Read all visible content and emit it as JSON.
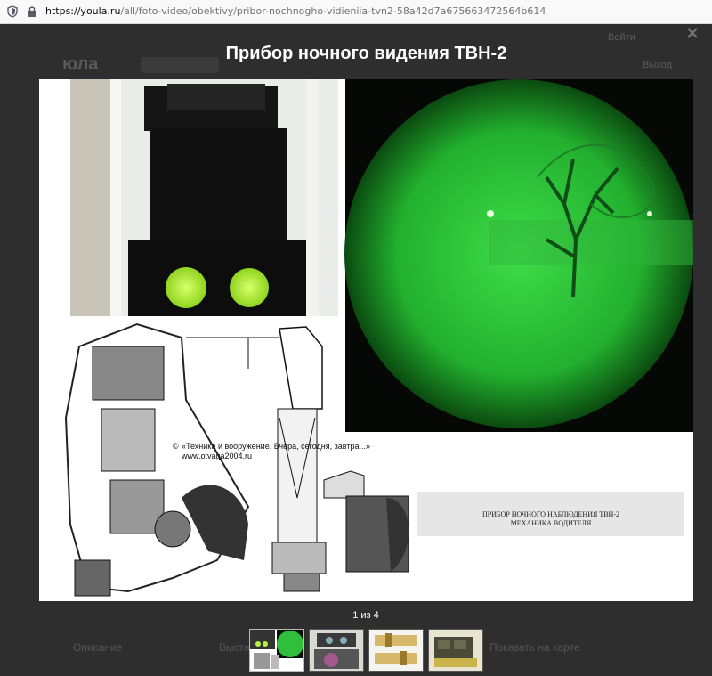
{
  "browser": {
    "url_host": "https://youla.ru",
    "url_path": "/all/foto-video/obektivy/pribor-nochnogho-vidieniia-tvn2-58a42d7a675663472564b614"
  },
  "background_page": {
    "logo": "юла",
    "header_right_1": "Войти",
    "header_right_2": "Выход",
    "footer_left": "Описание",
    "footer_mid": "Выставить",
    "footer_right": "Показать на карте"
  },
  "modal": {
    "title": "Прибор ночного видения ТВН-2",
    "counter": "1 из 4",
    "photo_caption_top": "«Техника и вооружение. Вчера, сегодня, завтра...»",
    "photo_caption_site": "www.otvaga2004.ru",
    "photo_caption_copy": "©",
    "photo_label_1": "ПРИБОР НОЧНОГО НАБЛЮДЕНИЯ ТВН-2",
    "photo_label_2": "МЕХАНИКА ВОДИТЕЛЯ",
    "thumbnails": [
      "thumbnail 1",
      "thumbnail 2",
      "thumbnail 3",
      "thumbnail 4"
    ]
  },
  "colors": {
    "backdrop": "#2b2b2b",
    "night_green": "#2fbf3a",
    "lens_green": "#b6f23a"
  }
}
